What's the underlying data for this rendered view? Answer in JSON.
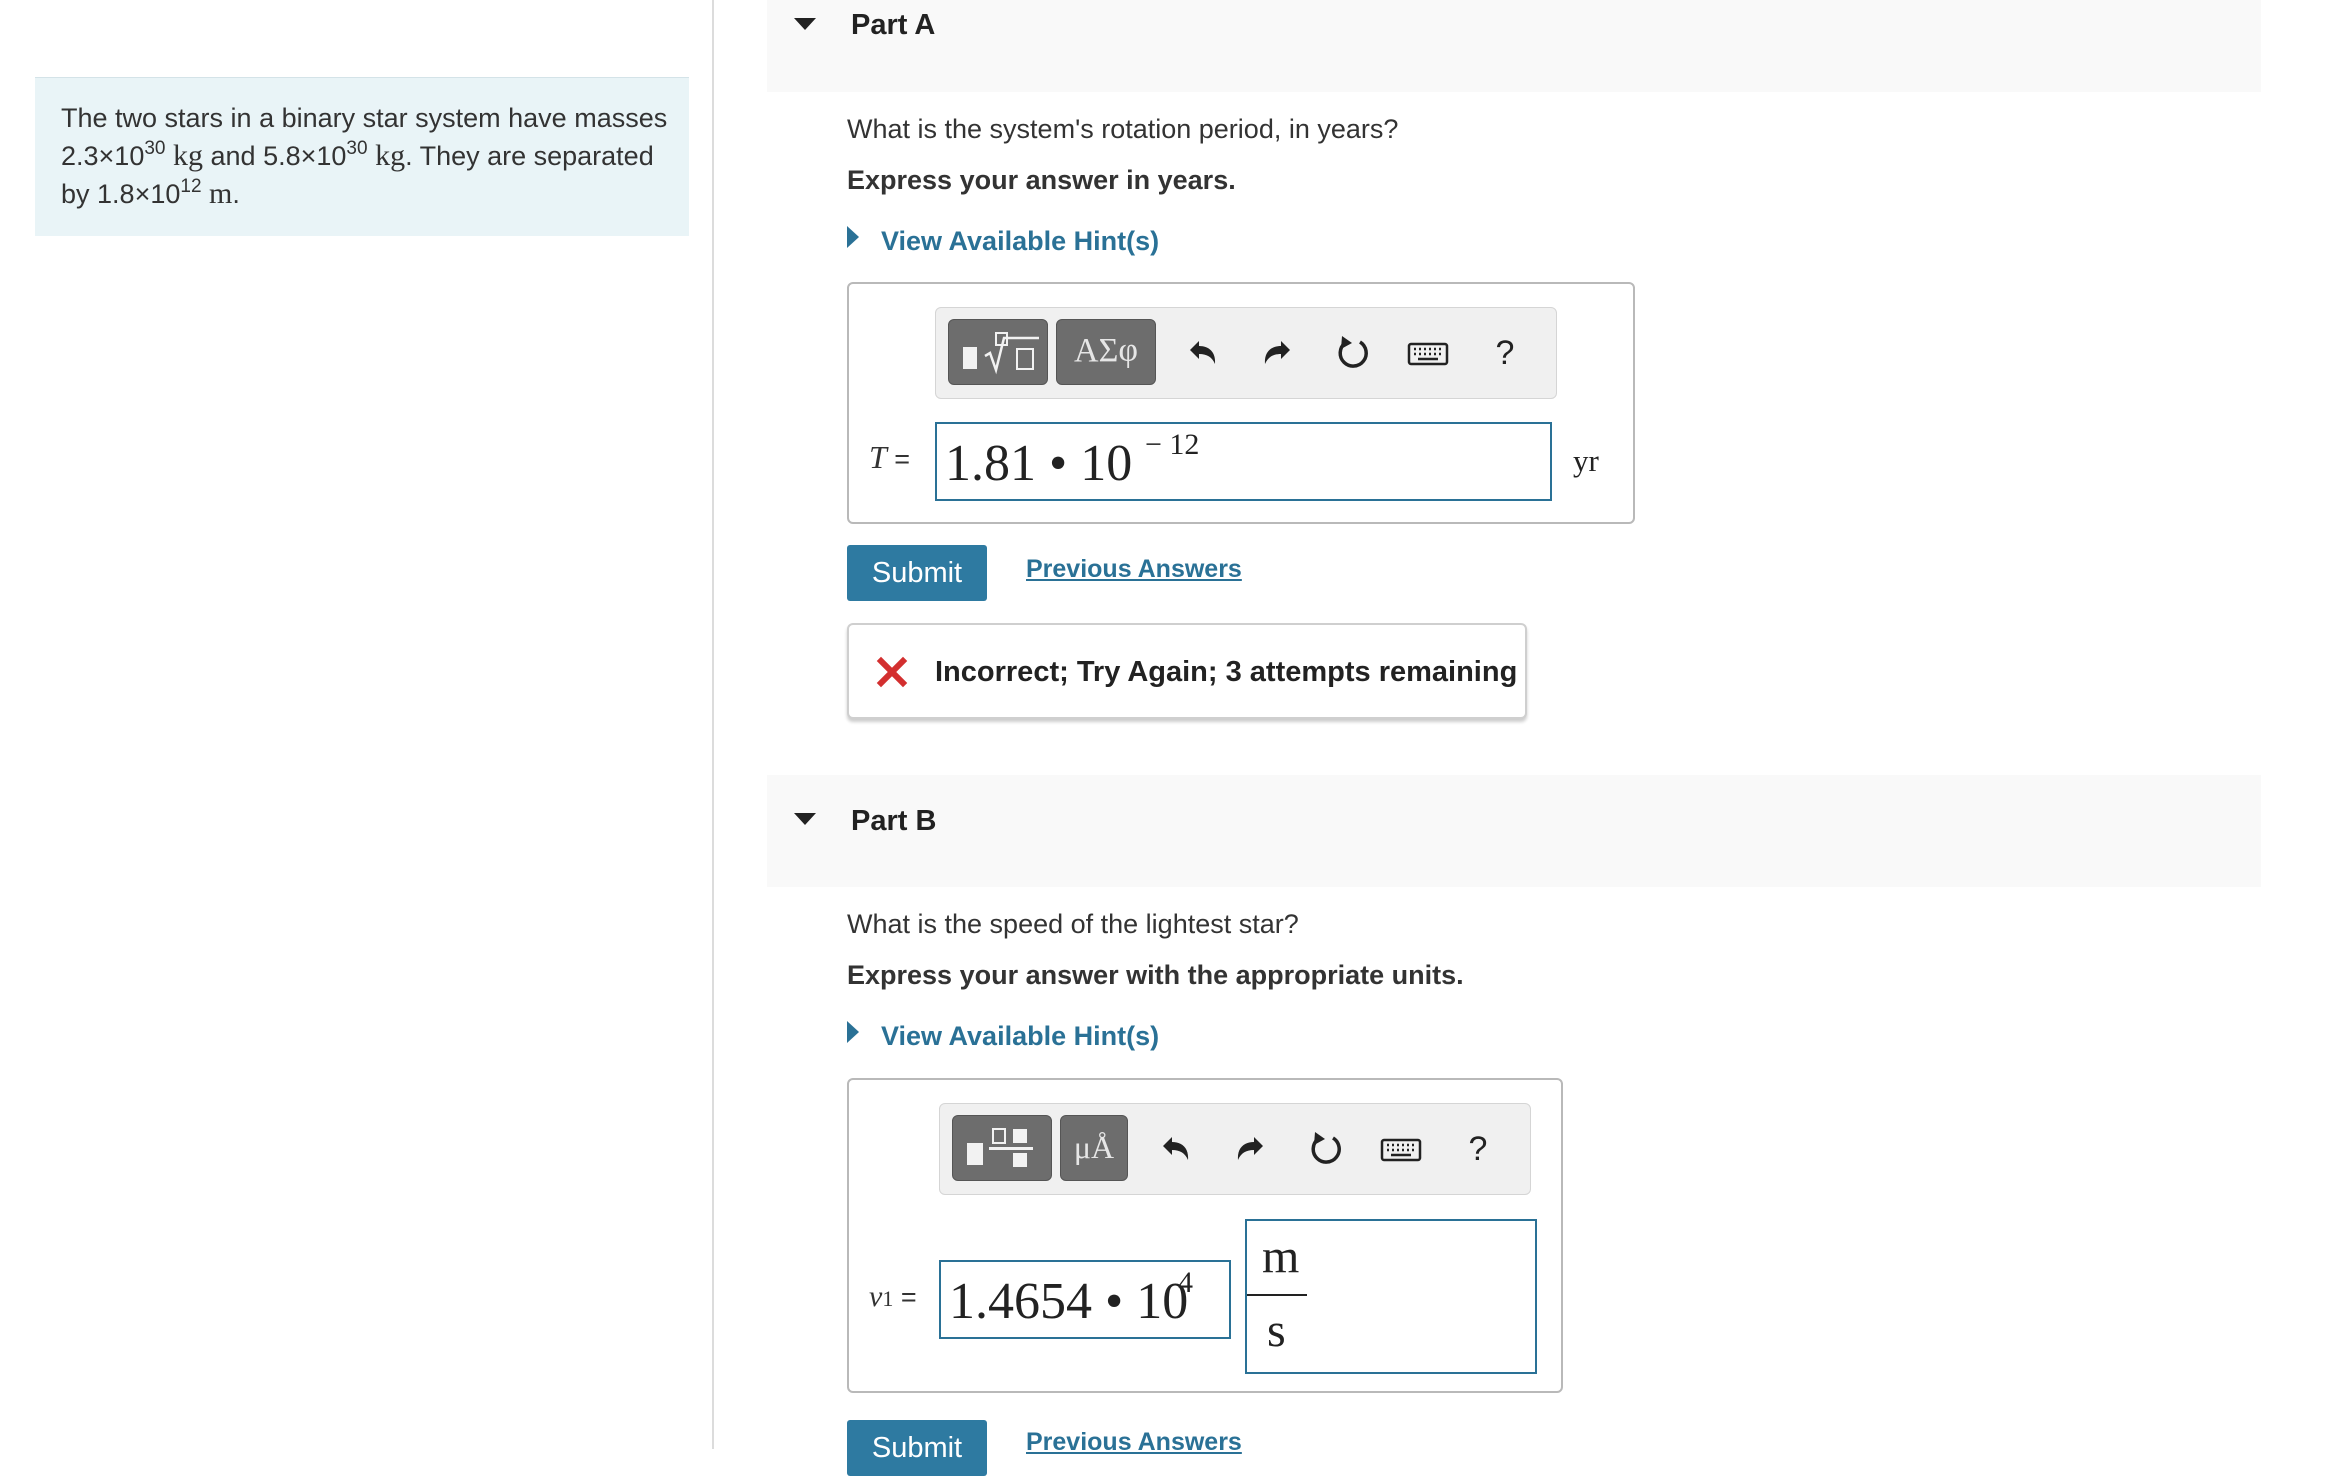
{
  "problem": {
    "intro": "The two stars in a binary star system have masses",
    "mass1_mantissa": "2.3×10",
    "mass1_exp": "30",
    "unit_kg": "kg",
    "and": " and ",
    "mass2_mantissa": "5.8×10",
    "mass2_exp": "30",
    "separated": ". They are separated by ",
    "dist_mantissa": "1.8×10",
    "dist_exp": "12",
    "unit_m": "m",
    "end": "."
  },
  "part_a": {
    "title": "Part A",
    "question": "What is the system's rotation period, in years?",
    "instruction": "Express your answer in years.",
    "hint": "View Available Hint(s)",
    "toolbar": {
      "templates_label": "ΑΣφ",
      "help": "?"
    },
    "variable": "T",
    "equals": " =",
    "answer_mantissa": "1.81 • 10",
    "answer_exp": "− 12",
    "unit": "yr",
    "submit": "Submit",
    "previous": "Previous Answers",
    "feedback": "Incorrect; Try Again; 3 attempts remaining",
    "status_color": "#d32f2f"
  },
  "part_b": {
    "title": "Part B",
    "question": "What is the speed of the lightest star?",
    "instruction": "Express your answer with the appropriate units.",
    "hint": "View Available Hint(s)",
    "toolbar": {
      "units_label": "μÅ",
      "help": "?"
    },
    "variable": "v",
    "subscript": "1",
    "equals": " =",
    "answer_mantissa": "1.4654 • 10",
    "answer_exp": "4",
    "unit_numerator": "m",
    "unit_denominator": "s",
    "submit": "Submit",
    "previous": "Previous Answers"
  },
  "accent_color": "#2a7196"
}
